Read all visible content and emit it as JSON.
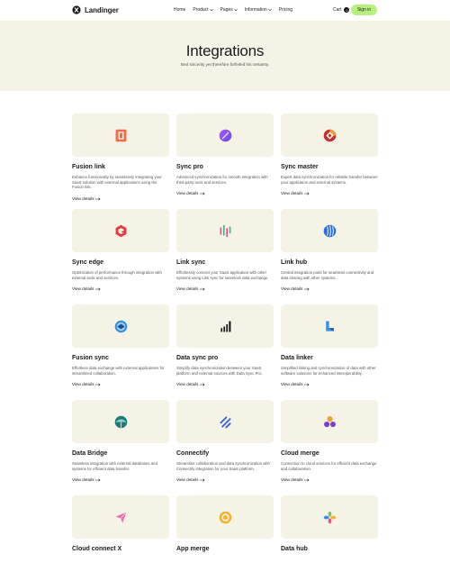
{
  "nav": {
    "brand": "Landinger",
    "menu": [
      "Home",
      "Product",
      "Pages",
      "Information",
      "Pricing"
    ],
    "cart_label": "Cart",
    "cart_count": "0",
    "signin_label": "Sign in"
  },
  "hero": {
    "title": "Integrations",
    "subtitle": "Bed sincerity yet therefore forfeited his certainty."
  },
  "link_label": "View details",
  "cards": [
    {
      "title": "Fusion link",
      "desc": "Enhance functionality by seamlessly integrating your SaaS solution with external applications using the Fusion link.",
      "icon": "fusion-link-logo"
    },
    {
      "title": "Sync pro",
      "desc": "Advanced synchronization for smooth integration with third-party tools and services.",
      "icon": "sync-pro-logo"
    },
    {
      "title": "Sync master",
      "desc": "Expert data synchronization for reliable transfer between your application and external systems.",
      "icon": "sync-master-logo"
    },
    {
      "title": "Sync edge",
      "desc": "Optimization of performance through integration with external tools and services.",
      "icon": "sync-edge-logo"
    },
    {
      "title": "Link sync",
      "desc": "Effortlessly connect your SaaS application with other systems using Link sync for seamless data exchange.",
      "icon": "link-sync-logo"
    },
    {
      "title": "Link hub",
      "desc": "Central integration point for seamless connectivity and data sharing with other systems.",
      "icon": "link-hub-logo"
    },
    {
      "title": "Fusion sync",
      "desc": "Effortless data exchange with external applications for streamlined collaboration.",
      "icon": "fusion-sync-logo"
    },
    {
      "title": "Data sync pro",
      "desc": "Simplify data synchronization between your SaaS platform and external sources with Data Sync Pro.",
      "icon": "data-sync-pro-logo"
    },
    {
      "title": "Data linker",
      "desc": "Simplified linking and synchronization of data with other software solutions for enhanced interoperability.",
      "icon": "data-linker-logo"
    },
    {
      "title": "Data Bridge",
      "desc": "Seamless integration with external databases and systems for efficient data transfer.",
      "icon": "data-bridge-logo"
    },
    {
      "title": "Connectify",
      "desc": "Streamline collaboration and data synchronization with Connectify integration for your SaaS platform.",
      "icon": "connectify-logo"
    },
    {
      "title": "Cloud merge",
      "desc": "Connection to cloud services for efficient data exchange and collaboration.",
      "icon": "cloud-merge-logo"
    },
    {
      "title": "Cloud connect X",
      "desc": "",
      "icon": "cloud-connect-x-logo"
    },
    {
      "title": "App merge",
      "desc": "",
      "icon": "app-merge-logo"
    },
    {
      "title": "Data hub",
      "desc": "",
      "icon": "data-hub-logo"
    }
  ],
  "colors": {
    "accent": "#b7f07f",
    "hero_bg": "#f4f3e5",
    "card_bg": "#f4f3e5"
  }
}
